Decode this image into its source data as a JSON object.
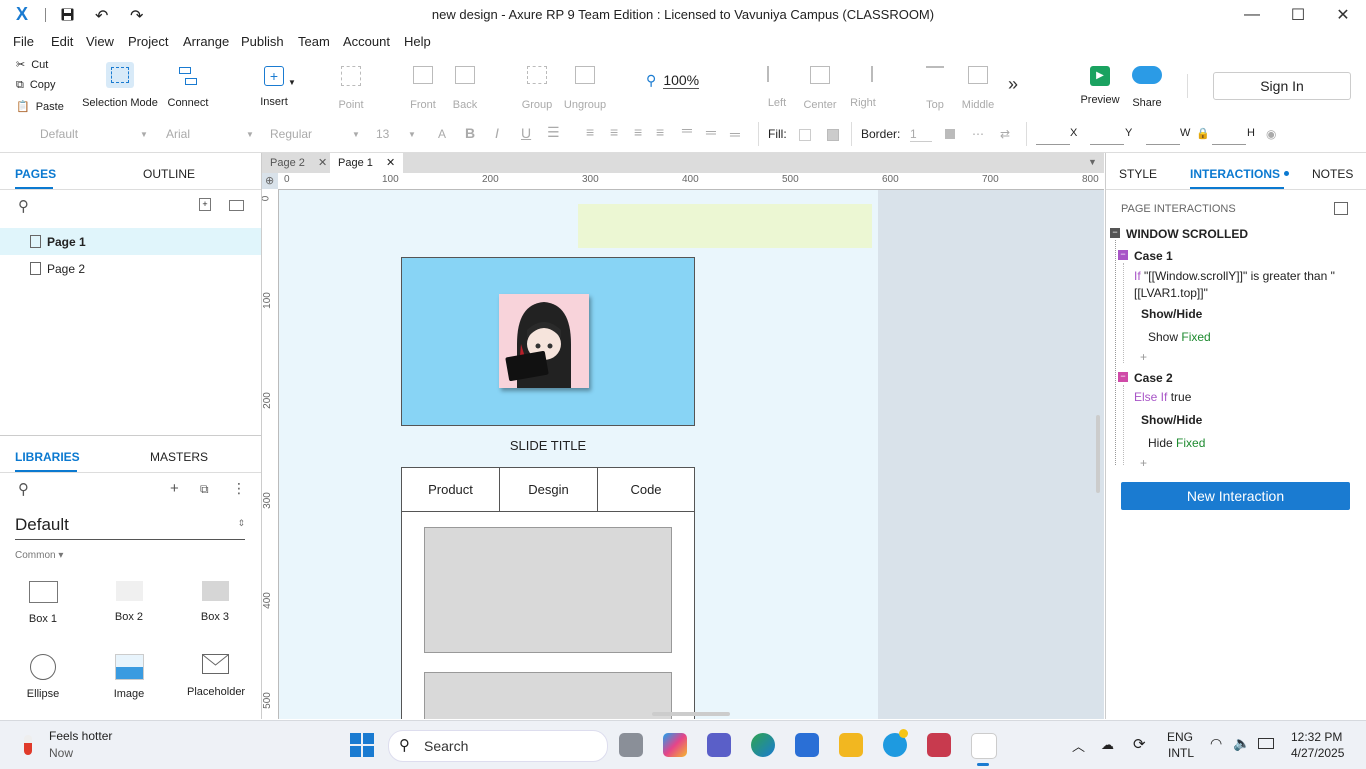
{
  "window": {
    "title": "new design - Axure RP 9 Team Edition : Licensed to Vavuniya Campus (CLASSROOM)",
    "logo": "X"
  },
  "menu": [
    "File",
    "Edit",
    "View",
    "Project",
    "Arrange",
    "Publish",
    "Team",
    "Account",
    "Help"
  ],
  "clipboard": {
    "cut": "Cut",
    "copy": "Copy",
    "paste": "Paste"
  },
  "toolbar": {
    "selection_mode": "Selection Mode",
    "connect": "Connect",
    "insert": "Insert",
    "point": "Point",
    "front": "Front",
    "back": "Back",
    "group": "Group",
    "ungroup": "Ungroup",
    "zoom": "100%",
    "left": "Left",
    "center": "Center",
    "right": "Right",
    "top": "Top",
    "middle": "Middle",
    "preview": "Preview",
    "share": "Share",
    "sign_in": "Sign In"
  },
  "format": {
    "style": "Default",
    "font": "Arial",
    "weight": "Regular",
    "size": "13",
    "fill_label": "Fill:",
    "border_label": "Border:",
    "border_value": "1",
    "x": "X",
    "y": "Y",
    "w": "W",
    "h": "H"
  },
  "left_panel": {
    "tabs": [
      "PAGES",
      "OUTLINE"
    ],
    "pages": [
      "Page 1",
      "Page 2"
    ],
    "lib_tabs": [
      "LIBRARIES",
      "MASTERS"
    ],
    "library": "Default",
    "category": "Common ▾",
    "widgets": [
      "Box 1",
      "Box 2",
      "Box 3",
      "Ellipse",
      "Image",
      "Placeholder"
    ]
  },
  "doc_tabs": [
    "Page 2",
    "Page 1"
  ],
  "ruler_h": [
    "0",
    "100",
    "200",
    "300",
    "400",
    "500",
    "600",
    "700",
    "800"
  ],
  "ruler_v": [
    "0",
    "100",
    "200",
    "300",
    "400",
    "500"
  ],
  "canvas": {
    "slide_title": "SLIDE TITLE",
    "tabs": [
      "Product",
      "Desgin",
      "Code"
    ]
  },
  "right_panel": {
    "tabs": [
      "STYLE",
      "INTERACTIONS",
      "NOTES"
    ],
    "section": "PAGE INTERACTIONS",
    "event": "WINDOW SCROLLED",
    "case1": {
      "name": "Case 1",
      "cond_kw": "If",
      "cond": "\"[[Window.scrollY]]\" is greater than \"[[LVAR1.top]]\"",
      "action": "Show/Hide",
      "verb": "Show",
      "target": "Fixed"
    },
    "case2": {
      "name": "Case 2",
      "cond_kw": "Else If",
      "cond": "true",
      "action": "Show/Hide",
      "verb": "Hide",
      "target": "Fixed"
    },
    "add": "+",
    "new_interaction": "New Interaction"
  },
  "taskbar": {
    "weather_title": "Feels hotter",
    "weather_sub": "Now",
    "search": "Search",
    "lang1": "ENG",
    "lang2": "INTL",
    "time": "12:32 PM",
    "date": "4/27/2025"
  },
  "colors": {
    "accent": "#0b79d0",
    "new_btn": "#1a7bd1",
    "case_purple": "#a855c7",
    "green": "#1d8a2f"
  }
}
